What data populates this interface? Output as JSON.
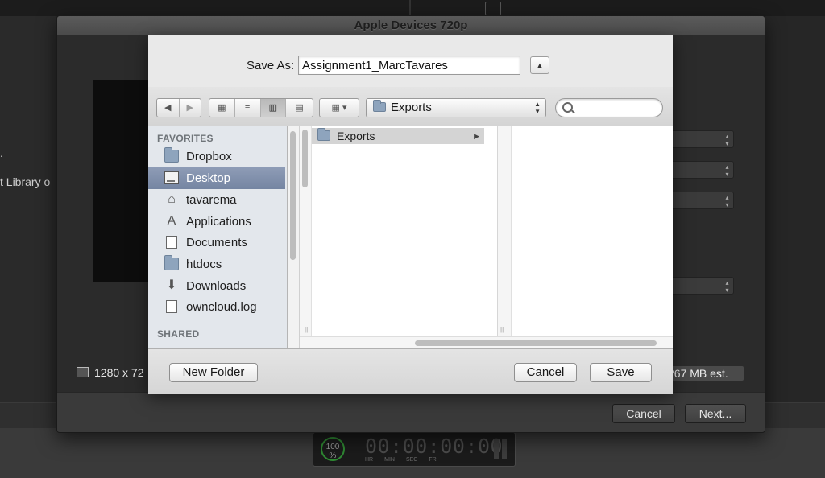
{
  "sheet": {
    "title": "Apple Devices 720p",
    "background_text_1": ".",
    "background_text_2": "t Library o",
    "resolution": "1280 x 72",
    "file_size": "267 MB est.",
    "cancel_label": "Cancel",
    "next_label": "Next..."
  },
  "timecode": {
    "zoom": "100",
    "zoom_unit": "%",
    "display": "00:00:00:00",
    "labels": [
      "HR",
      "MIN",
      "SEC",
      "FR"
    ]
  },
  "dialog": {
    "save_as_label": "Save As:",
    "filename": "Assignment1_MarcTavares",
    "current_folder": "Exports",
    "search_placeholder": "",
    "favorites_header": "FAVORITES",
    "shared_header": "SHARED",
    "favorites": [
      {
        "label": "Dropbox",
        "icon": "folder-icon",
        "selected": false
      },
      {
        "label": "Desktop",
        "icon": "desktop-icon",
        "selected": true
      },
      {
        "label": "tavarema",
        "icon": "home-icon",
        "selected": false
      },
      {
        "label": "Applications",
        "icon": "applications-icon",
        "selected": false
      },
      {
        "label": "Documents",
        "icon": "documents-icon",
        "selected": false
      },
      {
        "label": "htdocs",
        "icon": "folder-icon",
        "selected": false
      },
      {
        "label": "Downloads",
        "icon": "downloads-icon",
        "selected": false
      },
      {
        "label": "owncloud.log",
        "icon": "document-icon",
        "selected": false
      }
    ],
    "column_items": [
      {
        "label": "Exports",
        "icon": "folder-icon",
        "selected": true
      }
    ],
    "new_folder_label": "New Folder",
    "cancel_label": "Cancel",
    "save_label": "Save"
  }
}
